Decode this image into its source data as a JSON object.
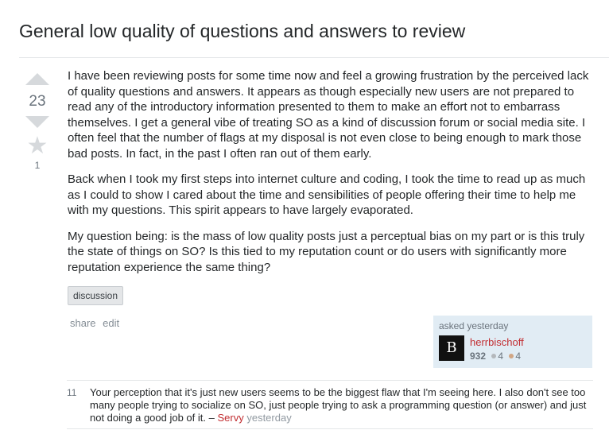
{
  "question": {
    "title": "General low quality of questions and answers to review",
    "vote_count": "23",
    "favorite_count": "1",
    "paragraphs": [
      "I have been reviewing posts for some time now and feel a growing frustration by the perceived lack of quality questions and answers. It appears as though especially new users are not prepared to read any of the introductory information presented to them to make an effort not to embarrass themselves. I get a general vibe of treating SO as a kind of discussion forum or social media site. I often feel that the number of flags at my disposal is not even close to being enough to mark those bad posts. In fact, in the past I often ran out of them early.",
      "Back when I took my first steps into internet culture and coding, I took the time to read up as much as I could to show I cared about the time and sensibilities of people offering their time to help me with my questions. This spirit appears to have largely evaporated.",
      "My question being: is the mass of low quality posts just a perceptual bias on my part or is this truly the state of things on SO? Is this tied to my reputation count or do users with significantly more reputation experience the same thing?"
    ],
    "tags": [
      "discussion"
    ],
    "menu": {
      "share": "share",
      "edit": "edit"
    }
  },
  "owner": {
    "asked_label": "asked yesterday",
    "avatar_glyph": "B",
    "username": "herrbischoff",
    "reputation": "932",
    "silver_badges": "4",
    "bronze_badges": "4"
  },
  "comments": [
    {
      "score": "11",
      "text": "Your perception that it's just new users seems to be the biggest flaw that I'm seeing here. I also don't see too many people trying to socialize on SO, just people trying to ask a programming question (or answer) and just not doing a good job of it.",
      "separator": " – ",
      "user": "Servy",
      "date": "yesterday"
    }
  ],
  "colors": {
    "link_user": "#c22e32",
    "owner_bg": "#e1ecf4",
    "vote_arrow": "#d6d9dc"
  },
  "icons": {
    "upvote": "upvote-arrow-icon",
    "downvote": "downvote-arrow-icon",
    "favorite": "star-icon",
    "silver_badge": "silver-badge-icon",
    "bronze_badge": "bronze-badge-icon"
  }
}
